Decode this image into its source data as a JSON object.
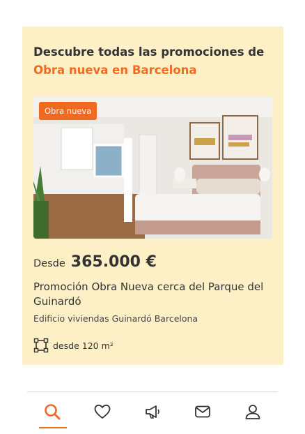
{
  "promo": {
    "heading_prefix": "Descubre todas las promociones de ",
    "heading_accent": "Obra nueva en Barcelona",
    "badge": "Obra nueva",
    "price_prefix": "Desde",
    "price": "365.000 €",
    "title": "Promoción Obra Nueva cerca del Parque del Guinardó",
    "subtitle": "Edificio viviendas Guinardó Barcelona",
    "area": "desde 120 m²"
  },
  "nav": {
    "items": [
      {
        "icon": "search-icon",
        "active": true
      },
      {
        "icon": "heart-icon",
        "active": false
      },
      {
        "icon": "megaphone-icon",
        "active": false
      },
      {
        "icon": "mail-icon",
        "active": false
      },
      {
        "icon": "user-icon",
        "active": false
      }
    ]
  },
  "colors": {
    "accent": "#f26a21",
    "card_bg": "#fdf0c6"
  }
}
